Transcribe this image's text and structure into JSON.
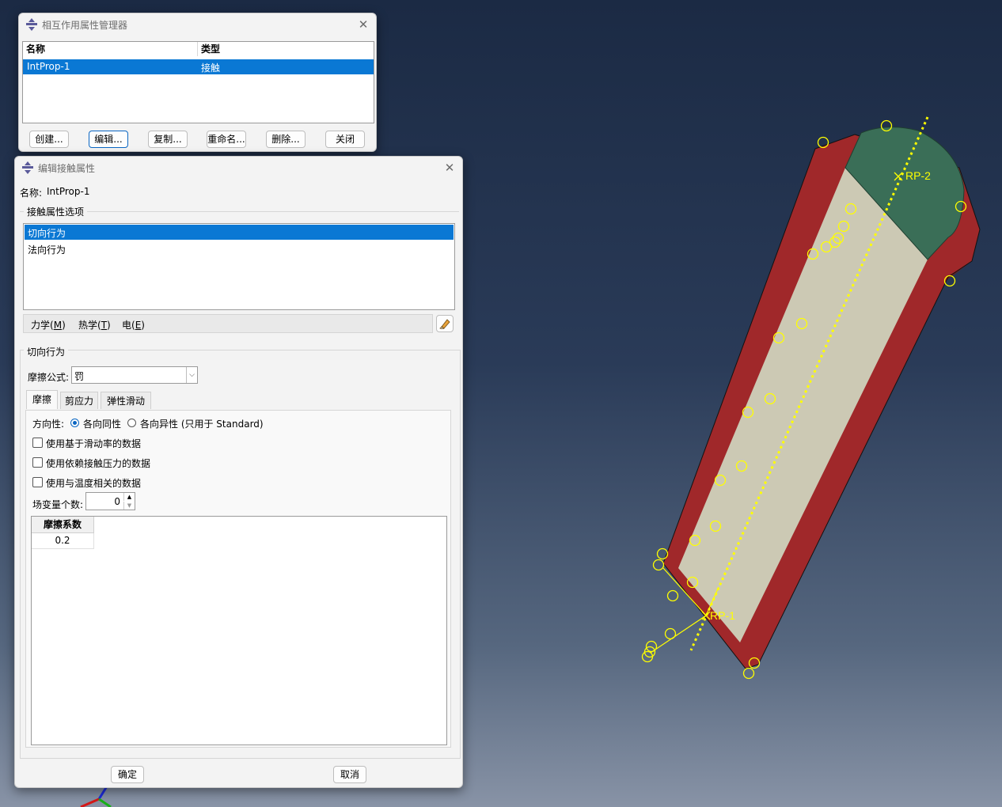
{
  "viewport": {
    "rp1_label": "RP-1",
    "rp2_label": "RP-2",
    "colors": {
      "outer_wall": "#a0282a",
      "inner_surface": "#ccc9b4",
      "end_cap": "#3a6e57",
      "constraint": "#ffff00"
    }
  },
  "manager": {
    "title": "相互作用属性管理器",
    "columns": [
      "名称",
      "类型"
    ],
    "rows": [
      {
        "name": "IntProp-1",
        "type": "接触",
        "selected": true
      }
    ],
    "buttons": {
      "create": "创建...",
      "edit": "编辑...",
      "copy": "复制...",
      "rename": "重命名...",
      "delete": "删除...",
      "close": "关闭"
    }
  },
  "edit": {
    "title": "编辑接触属性",
    "name_label": "名称:",
    "name_value": "IntProp-1",
    "options_group": "接触属性选项",
    "options": [
      {
        "label": "切向行为",
        "selected": true
      },
      {
        "label": "法向行为",
        "selected": false
      }
    ],
    "menu": {
      "mechanical": "力学",
      "mechanical_key": "M",
      "thermal": "热学",
      "thermal_key": "T",
      "electrical": "电",
      "electrical_key": "E"
    },
    "section_title": "切向行为",
    "friction_formula_label": "摩擦公式:",
    "friction_formula_value": "罚",
    "tabs": [
      "摩擦",
      "剪应力",
      "弹性滑动"
    ],
    "directionality_label": "方向性:",
    "radio_isotropic": "各向同性",
    "radio_anisotropic": "各向异性 (只用于 Standard)",
    "check_slip_rate": "使用基于滑动率的数据",
    "check_pressure": "使用依赖接触压力的数据",
    "check_temperature": "使用与温度相关的数据",
    "field_vars_label": "场变量个数:",
    "field_vars_value": "0",
    "table_header": "摩擦系数",
    "table_value": "0.2",
    "ok": "确定",
    "cancel": "取消"
  }
}
